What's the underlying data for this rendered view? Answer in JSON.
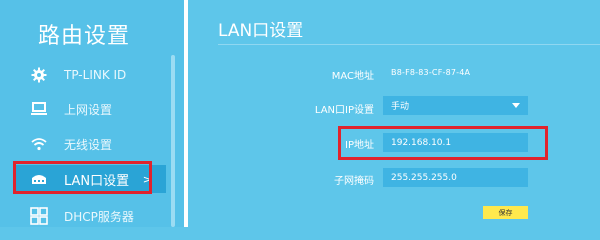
{
  "sidebar": {
    "title": "路由设置",
    "items": [
      {
        "label": "TP-LINK ID",
        "icon": "gear-icon"
      },
      {
        "label": "上网设置",
        "icon": "monitor-icon"
      },
      {
        "label": "无线设置",
        "icon": "wifi-icon"
      },
      {
        "label": "LAN口设置",
        "icon": "router-icon",
        "active": true,
        "chevron": ">"
      },
      {
        "label": "DHCP服务器",
        "icon": "dhcp-icon"
      }
    ]
  },
  "main": {
    "title": "LAN口设置",
    "mac": {
      "label": "MAC地址",
      "value": "B8-F8-83-CF-87-4A"
    },
    "lan_ip_setting": {
      "label": "LAN口IP设置",
      "value": "手动"
    },
    "ip_address": {
      "label": "IP地址",
      "value": "192.168.10.1"
    },
    "subnet_mask": {
      "label": "子网掩码",
      "value": "255.255.255.0"
    },
    "save_label": "保存"
  },
  "colors": {
    "background": "#5ec6ea",
    "active_item": "#2aa4d6",
    "field": "#3fb4e3",
    "highlight": "#e0232d",
    "save_button": "#ffe94d"
  }
}
